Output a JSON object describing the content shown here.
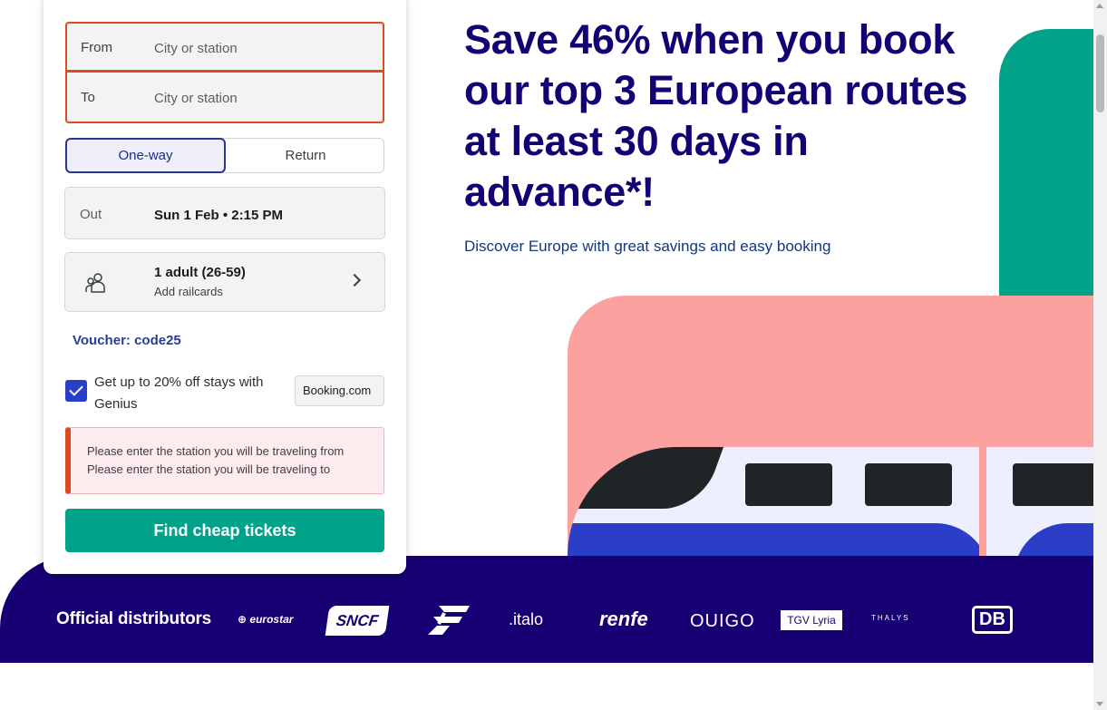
{
  "search_form": {
    "from": {
      "label": "From",
      "placeholder": "City or station"
    },
    "to": {
      "label": "To",
      "placeholder": "City or station"
    },
    "trip_type": {
      "options": [
        "One-way",
        "Return"
      ],
      "selected": "One-way"
    },
    "outbound": {
      "label": "Out",
      "value": "Sun 1 Feb • 2:15 PM"
    },
    "passengers": {
      "summary": "1 adult (26-59)",
      "railcards": "Add railcards",
      "icon": "passengers-icon"
    },
    "voucher": "Voucher: code25",
    "genius": {
      "checked": true,
      "text": "Get up to 20% off stays with Genius",
      "partner": "Booking.com"
    },
    "errors": [
      "Please enter the station you will be traveling from",
      "Please enter the station you will be traveling to"
    ],
    "submit_label": "Find cheap tickets"
  },
  "hero": {
    "headline": "Save 46% when you book our top 3 European routes at least 30 days in advance*!",
    "subline": "Discover Europe with great savings and easy booking"
  },
  "distributors": {
    "title": "Official distributors",
    "logos": {
      "eurostar": "⊕ eurostar",
      "sncf": "SNCF",
      "trenitalia": "trenitalia-logo",
      "italo": ".italo",
      "renfe": "renfe",
      "ouigo": "OUIGO",
      "tgv_lyria": "TGV Lyria",
      "thalys": "THALYS",
      "db": "DB"
    }
  },
  "colors": {
    "navy": "#170073",
    "teal": "#00a28a",
    "pink": "#fba1a0",
    "blue": "#2a3ec8",
    "error": "#e04a1e"
  }
}
